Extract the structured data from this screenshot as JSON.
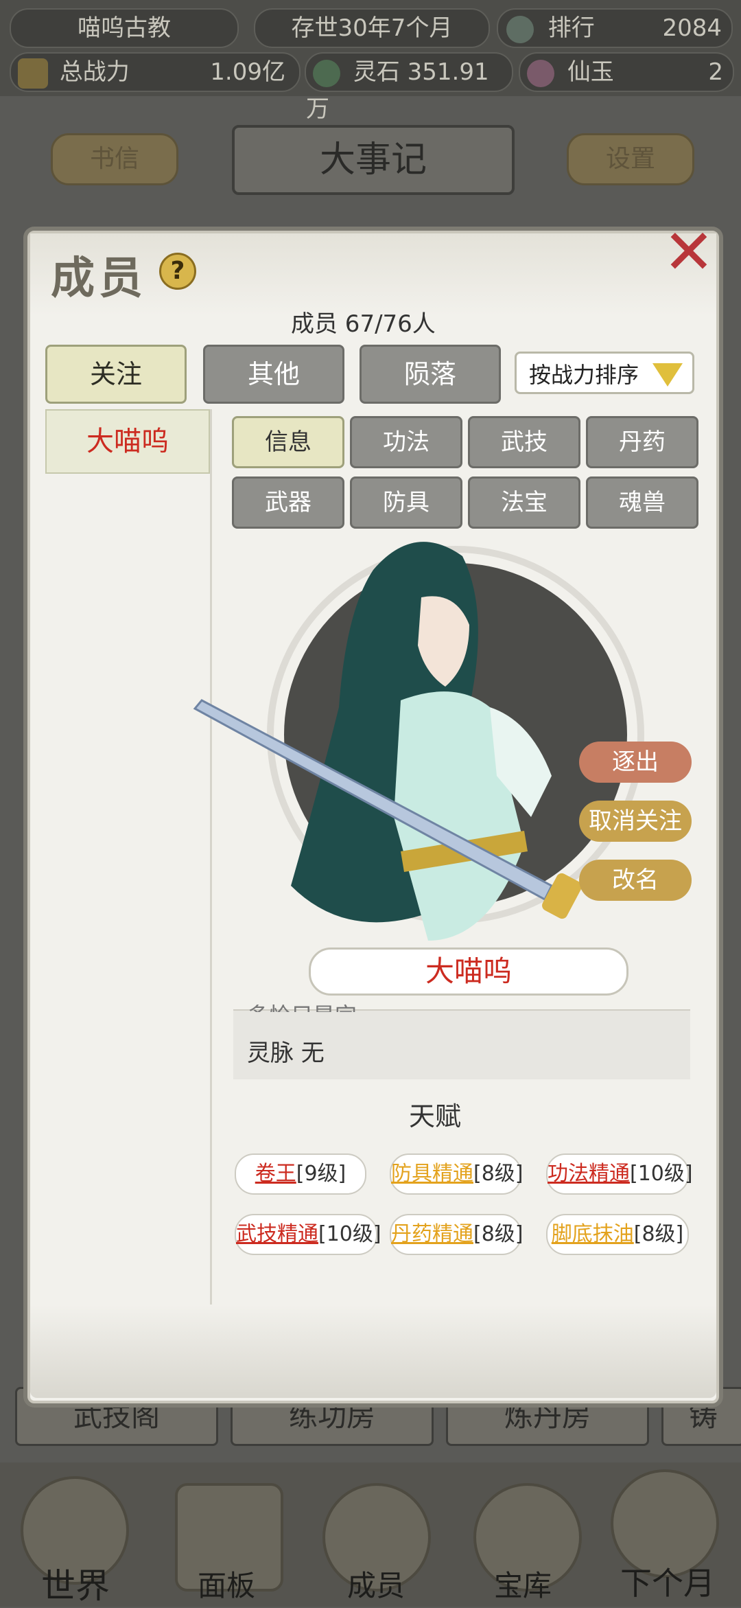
{
  "topbar": {
    "sect_name": "喵呜古教",
    "age": "存世30年7个月",
    "rank_label": "排行",
    "rank_value": "2084",
    "power_label": "总战力",
    "power_value": "1.09亿",
    "spirit_stone": "灵石 351.91万",
    "jade_label": "仙玉",
    "jade_value": "2"
  },
  "header": {
    "letters_button": "书信",
    "title": "大事记",
    "settings_button": "设置"
  },
  "modal": {
    "title": "成员",
    "member_count": "成员  67/76人",
    "tabs": [
      "关注",
      "其他",
      "陨落"
    ],
    "sort_label": "按战力排序",
    "list": [
      "大喵呜"
    ],
    "subtabs": [
      "信息",
      "功法",
      "武技",
      "丹药",
      "武器",
      "防具",
      "法宝",
      "魂兽"
    ],
    "actions": {
      "expel": "逐出",
      "unfollow": "取消关注",
      "rename": "改名"
    },
    "member_name": "大喵呜",
    "partial_row": "多恰只是完",
    "spirit_vein": "灵脉 无",
    "talent_title": "天赋",
    "talents": [
      {
        "name": "卷王",
        "level": "[9级]",
        "color": "#cc2b20"
      },
      {
        "name": "防具精通",
        "level": "[8级]",
        "color": "#e3a21d"
      },
      {
        "name": "功法精通",
        "level": "[10级]",
        "color": "#cc2b20"
      },
      {
        "name": "武技精通",
        "level": "[10级]",
        "color": "#cc2b20"
      },
      {
        "name": "丹药精通",
        "level": "[8级]",
        "color": "#e3a21d"
      },
      {
        "name": "脚底抹油",
        "level": "[8级]",
        "color": "#e3a21d"
      }
    ]
  },
  "buildings": [
    "武技阁",
    "练功房",
    "炼丹房",
    "铸"
  ],
  "bottom_nav": [
    "世界",
    "面板",
    "成员",
    "宝库",
    "下个月"
  ]
}
